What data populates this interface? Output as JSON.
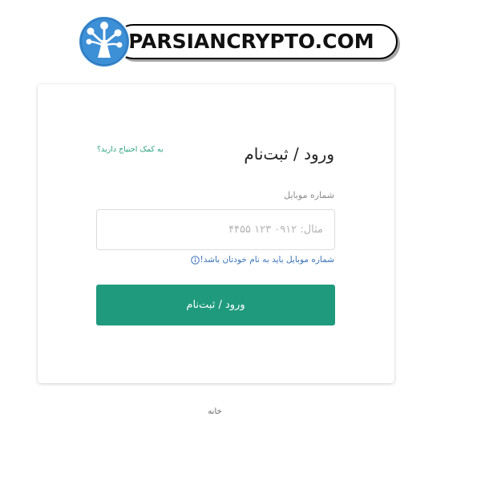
{
  "banner": {
    "text": "PARSIANCRYPTO.COM"
  },
  "card": {
    "title": "ورود / ثبت‌نام",
    "help_link": "به کمک احتیاج دارید؟",
    "phone_label": "شماره موبایل",
    "phone_value": "",
    "phone_placeholder": "مثال: ۰۹۱۲ ۱۲۳ ۴۴۵۵",
    "hint_text": "شماره موبایل باید به نام خودتان باشد!",
    "submit_label": "ورود / ثبت‌نام"
  },
  "footer": {
    "home_link": "خانه"
  },
  "colors": {
    "accent": "#1f9a7d",
    "help_link": "#2aa17e",
    "hint": "#3a73b8",
    "logo_blue": "#3d8fd6"
  },
  "icons": {
    "hint": "info-circle-icon",
    "logo": "tree-logo-icon"
  }
}
